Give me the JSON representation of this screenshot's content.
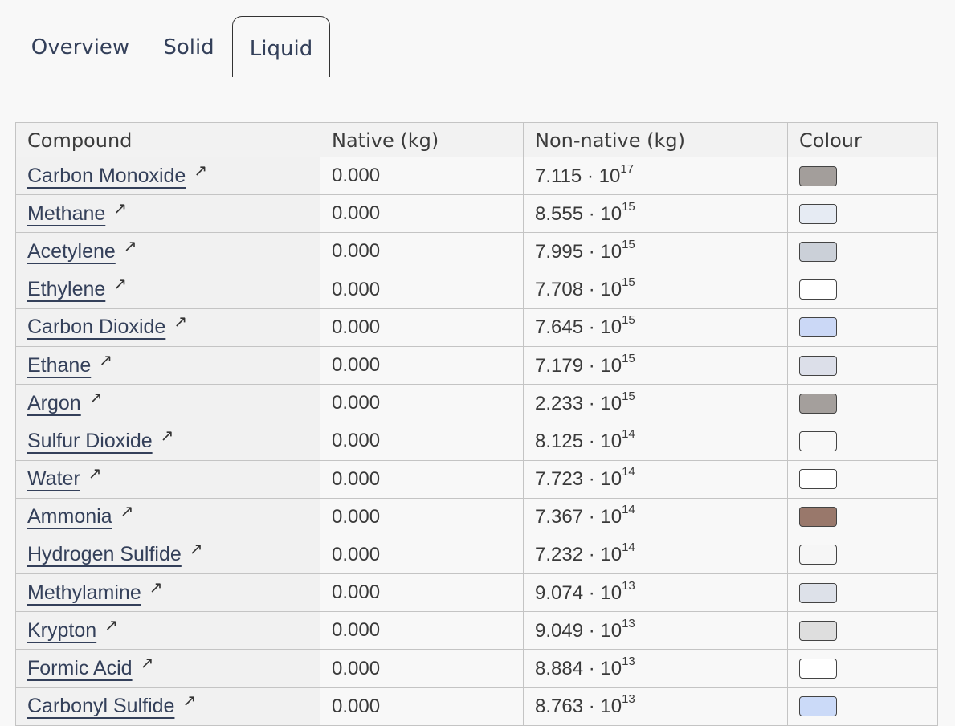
{
  "tabs": [
    {
      "label": "Overview",
      "active": false
    },
    {
      "label": "Solid",
      "active": false
    },
    {
      "label": "Liquid",
      "active": true
    }
  ],
  "table": {
    "headers": [
      "Compound",
      "Native (kg)",
      "Non-native (kg)",
      "Colour"
    ],
    "link_icon": "external-link-arrow-icon",
    "rows": [
      {
        "compound": "Carbon Monoxide",
        "native": "0.000",
        "mantissa": "7.115 · 10",
        "exp": "17",
        "colour": "#a39e9b"
      },
      {
        "compound": "Methane",
        "native": "0.000",
        "mantissa": "8.555 · 10",
        "exp": "15",
        "colour": "#e6ebf3"
      },
      {
        "compound": "Acetylene",
        "native": "0.000",
        "mantissa": "7.995 · 10",
        "exp": "15",
        "colour": "#cbd0d8"
      },
      {
        "compound": "Ethylene",
        "native": "0.000",
        "mantissa": "7.708 · 10",
        "exp": "15",
        "colour": "#ffffff"
      },
      {
        "compound": "Carbon Dioxide",
        "native": "0.000",
        "mantissa": "7.645 · 10",
        "exp": "15",
        "colour": "#cbd8f6"
      },
      {
        "compound": "Ethane",
        "native": "0.000",
        "mantissa": "7.179 · 10",
        "exp": "15",
        "colour": "#dcdfe9"
      },
      {
        "compound": "Argon",
        "native": "0.000",
        "mantissa": "2.233 · 10",
        "exp": "15",
        "colour": "#a49f9c"
      },
      {
        "compound": "Sulfur Dioxide",
        "native": "0.000",
        "mantissa": "8.125 · 10",
        "exp": "14",
        "colour": "#f8f8f8"
      },
      {
        "compound": "Water",
        "native": "0.000",
        "mantissa": "7.723 · 10",
        "exp": "14",
        "colour": "#ffffff"
      },
      {
        "compound": "Ammonia",
        "native": "0.000",
        "mantissa": "7.367 · 10",
        "exp": "14",
        "colour": "#99786b"
      },
      {
        "compound": "Hydrogen Sulfide",
        "native": "0.000",
        "mantissa": "7.232 · 10",
        "exp": "14",
        "colour": "#f6f6f6"
      },
      {
        "compound": "Methylamine",
        "native": "0.000",
        "mantissa": "9.074 · 10",
        "exp": "13",
        "colour": "#dde1e9"
      },
      {
        "compound": "Krypton",
        "native": "0.000",
        "mantissa": "9.049 · 10",
        "exp": "13",
        "colour": "#dedede"
      },
      {
        "compound": "Formic Acid",
        "native": "0.000",
        "mantissa": "8.884 · 10",
        "exp": "13",
        "colour": "#ffffff"
      },
      {
        "compound": "Carbonyl Sulfide",
        "native": "0.000",
        "mantissa": "8.763 · 10",
        "exp": "13",
        "colour": "#cbdaf8"
      }
    ]
  }
}
